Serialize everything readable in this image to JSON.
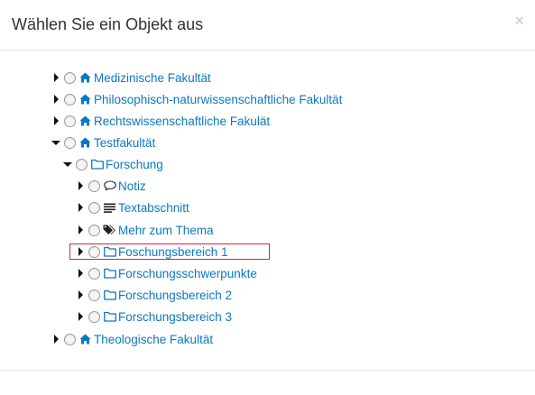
{
  "dialog": {
    "title": "Wählen Sie ein Objekt aus",
    "close": "×"
  },
  "tree": [
    {
      "label": "Medizinische Fakultät",
      "icon": "home-icon",
      "expanded": false
    },
    {
      "label": "Philosophisch-naturwissenschaftliche Fakultät",
      "icon": "home-icon",
      "expanded": false
    },
    {
      "label": "Rechtswissenschaftliche Fakulät",
      "icon": "home-icon",
      "expanded": false
    },
    {
      "label": "Testfakultät",
      "icon": "home-icon",
      "expanded": true
    },
    {
      "label": "Forschung",
      "icon": "folder-icon",
      "expanded": true
    },
    {
      "label": "Notiz",
      "icon": "comment-icon",
      "expanded": false
    },
    {
      "label": "Textabschnitt",
      "icon": "text-lines-icon",
      "expanded": false
    },
    {
      "label": "Mehr zum Thema",
      "icon": "tags-icon",
      "expanded": false
    },
    {
      "label": "Foschungsbereich 1",
      "icon": "folder-icon",
      "expanded": false,
      "highlighted": true
    },
    {
      "label": "Forschungsschwerpunkte",
      "icon": "folder-icon",
      "expanded": false
    },
    {
      "label": "Forschungsbereich 2",
      "icon": "folder-icon",
      "expanded": false
    },
    {
      "label": "Forschungsbereich 3",
      "icon": "folder-icon",
      "expanded": false
    },
    {
      "label": "Theologische Fakultät",
      "icon": "home-icon",
      "expanded": false
    }
  ],
  "colors": {
    "link": "#0b78c2",
    "highlight_border": "#d9234b"
  }
}
